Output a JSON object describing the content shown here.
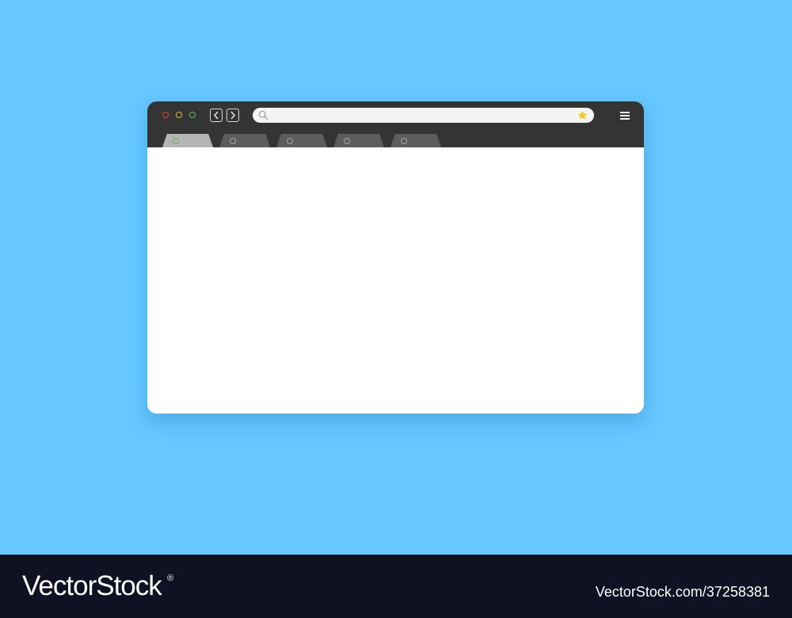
{
  "browser": {
    "window_controls": [
      {
        "name": "close",
        "color": "#e0492f"
      },
      {
        "name": "minimize",
        "color": "#e7b62a"
      },
      {
        "name": "maximize",
        "color": "#59c85b"
      }
    ],
    "nav": {
      "back_icon": "chevron-left-icon",
      "forward_icon": "chevron-right-icon"
    },
    "address_bar": {
      "value": "",
      "search_icon": "search-icon",
      "bookmark_icon": "star-icon",
      "bookmark_color": "#f5c518"
    },
    "menu_icon": "hamburger-menu-icon",
    "tabs": [
      {
        "active": true,
        "indicator_color": "#52c54a"
      },
      {
        "active": false
      },
      {
        "active": false
      },
      {
        "active": false
      },
      {
        "active": false
      }
    ],
    "colors": {
      "background": "#66c8ff",
      "toolbar": "#343434",
      "content": "#ffffff"
    }
  },
  "footer": {
    "logo": "VectorStock",
    "registered": "®",
    "image_id": "VectorStock.com/37258381"
  }
}
